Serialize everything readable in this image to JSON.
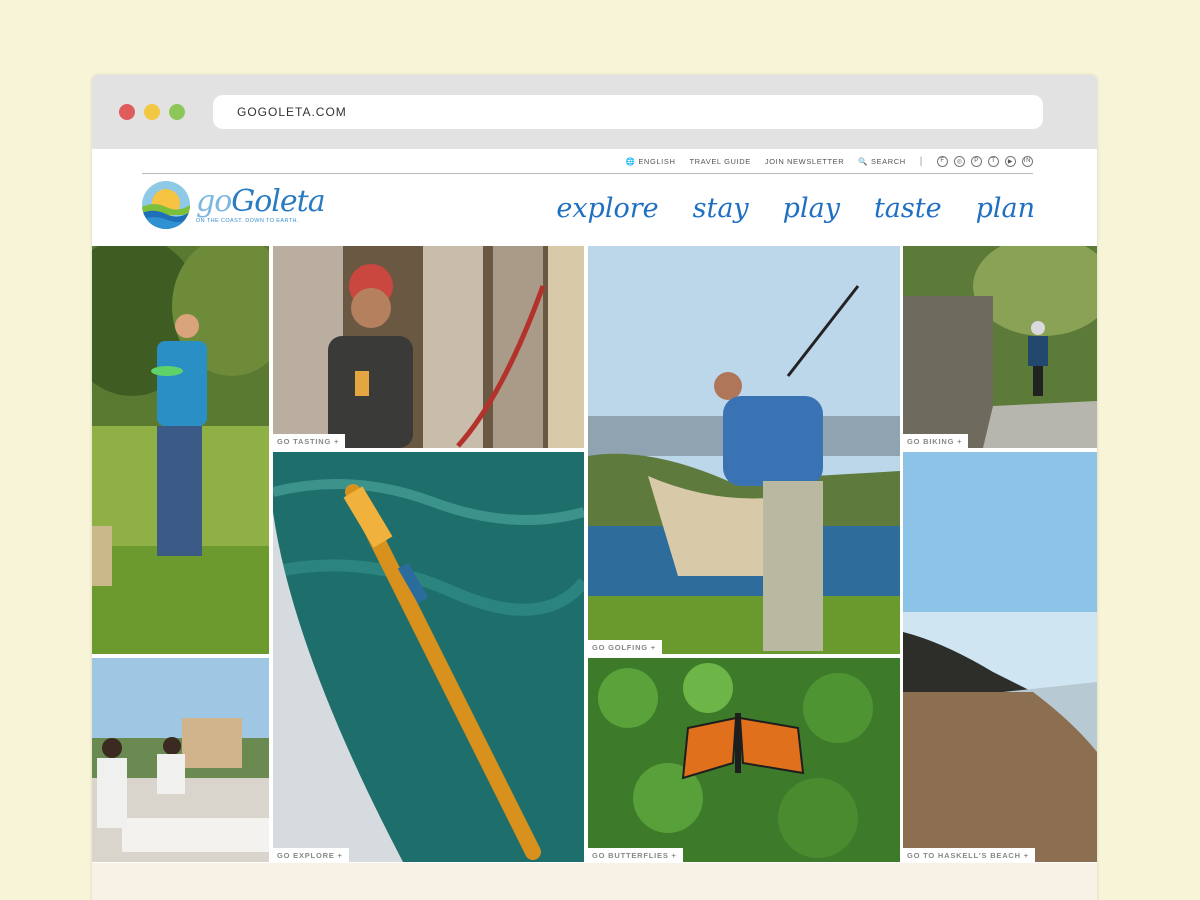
{
  "browser": {
    "url": "GOGOLETA.COM"
  },
  "utility_nav": {
    "language": "ENGLISH",
    "travel_guide": "TRAVEL GUIDE",
    "newsletter": "JOIN NEWSLETTER",
    "search": "SEARCH",
    "separator": "|",
    "social_icons": [
      "facebook-icon",
      "instagram-icon",
      "pinterest-icon",
      "twitter-icon",
      "youtube-icon",
      "linkedin-icon"
    ]
  },
  "logo": {
    "go": "go",
    "goleta": "Goleta",
    "tagline": "ON THE COAST. DOWN TO EARTH."
  },
  "main_nav": [
    "explore",
    "stay",
    "play",
    "taste",
    "plan"
  ],
  "tiles": {
    "frisbee": {
      "label": ""
    },
    "tasting": {
      "label": "GO TASTING"
    },
    "golfing": {
      "label": "GO GOLFING"
    },
    "biking": {
      "label": "GO BIKING"
    },
    "massage": {
      "label": ""
    },
    "explore": {
      "label": "GO EXPLORE"
    },
    "butterflies": {
      "label": "GO BUTTERFLIES"
    },
    "beach": {
      "label": "GO TO HASKELL'S BEACH"
    }
  },
  "colors": {
    "background": "#f8f4d8",
    "brand_blue": "#1f6fc2",
    "chrome": "#e2e2e2"
  }
}
